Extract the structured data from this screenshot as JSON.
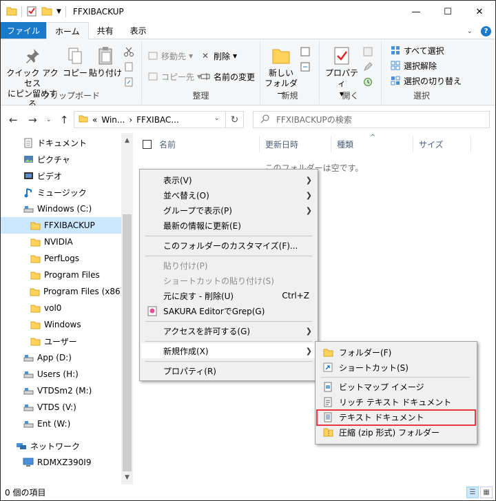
{
  "window": {
    "title": "FFXIBACKUP",
    "controls": {
      "minimize": "—",
      "maximize": "☐",
      "close": "✕"
    }
  },
  "tabs": [
    {
      "label": "ファイル"
    },
    {
      "label": "ホーム"
    },
    {
      "label": "共有"
    },
    {
      "label": "表示"
    }
  ],
  "ribbon": {
    "clipboard": {
      "label": "クリップボード",
      "pin_line1": "クイック アクセス",
      "pin_line2": "にピン留めする",
      "copy": "コピー",
      "paste": "貼り付け"
    },
    "organize": {
      "label": "整理",
      "move_to": "移動先",
      "copy_to": "コピー先",
      "delete": "削除",
      "rename": "名前の変更"
    },
    "new": {
      "label": "新規",
      "new_folder_line1": "新しい",
      "new_folder_line2": "フォルダー"
    },
    "open": {
      "label": "開く",
      "properties": "プロパティ"
    },
    "select": {
      "label": "選択",
      "select_all": "すべて選択",
      "select_none": "選択解除",
      "invert": "選択の切り替え"
    }
  },
  "address": {
    "prefix": "«",
    "crumb1": "Win...",
    "crumb2": "FFXIBAC...",
    "search_placeholder": "FFXIBACKUPの検索"
  },
  "nav": [
    {
      "label": "ドキュメント",
      "icon": "document-icon"
    },
    {
      "label": "ピクチャ",
      "icon": "pictures-icon"
    },
    {
      "label": "ビデオ",
      "icon": "video-icon"
    },
    {
      "label": "ミュージック",
      "icon": "music-icon"
    },
    {
      "label": "Windows (C:)",
      "icon": "drive-icon"
    },
    {
      "label": "FFXIBACKUP",
      "icon": "folder-icon",
      "selected": true
    },
    {
      "label": "NVIDIA",
      "icon": "folder-icon"
    },
    {
      "label": "PerfLogs",
      "icon": "folder-icon"
    },
    {
      "label": "Program Files",
      "icon": "folder-icon"
    },
    {
      "label": "Program Files (x86)",
      "icon": "folder-icon"
    },
    {
      "label": "vol0",
      "icon": "folder-icon"
    },
    {
      "label": "Windows",
      "icon": "folder-icon"
    },
    {
      "label": "ユーザー",
      "icon": "folder-icon"
    },
    {
      "label": "App (D:)",
      "icon": "drive-icon"
    },
    {
      "label": "Users (H:)",
      "icon": "drive-icon"
    },
    {
      "label": "VTDSm2 (M:)",
      "icon": "drive-icon"
    },
    {
      "label": "VTDS (V:)",
      "icon": "drive-icon"
    },
    {
      "label": "Ent (W:)",
      "icon": "drive-icon"
    },
    {
      "label": "ネットワーク",
      "icon": "network-icon"
    },
    {
      "label": "RDMXZ390I9",
      "icon": "computer-icon"
    }
  ],
  "columns": {
    "name": "名前",
    "modified": "更新日時",
    "type": "種類",
    "size": "サイズ"
  },
  "empty_message": "このフォルダーは空です。",
  "status": {
    "item_count": "0 個の項目"
  },
  "context_menu": {
    "view": "表示(V)",
    "sort": "並べ替え(O)",
    "group": "グループで表示(P)",
    "refresh": "最新の情報に更新(E)",
    "customize": "このフォルダーのカスタマイズ(F)...",
    "paste": "貼り付け(P)",
    "paste_shortcut": "ショートカットの貼り付け(S)",
    "undo": "元に戻す - 削除(U)",
    "undo_shortcut": "Ctrl+Z",
    "sakura": "SAKURA EditorでGrep(G)",
    "access": "アクセスを許可する(G)",
    "new": "新規作成(X)",
    "properties": "プロパティ(R)"
  },
  "submenu": {
    "folder": "フォルダー(F)",
    "shortcut": "ショートカット(S)",
    "bitmap": "ビットマップ イメージ",
    "rtf": "リッチ テキスト ドキュメント",
    "text": "テキスト ドキュメント",
    "zip": "圧縮 (zip 形式) フォルダー"
  },
  "colors": {
    "accent": "#1979ca",
    "folder": "#ffd35c",
    "selection": "#cce8ff",
    "highlight_box": "#e8383d"
  }
}
